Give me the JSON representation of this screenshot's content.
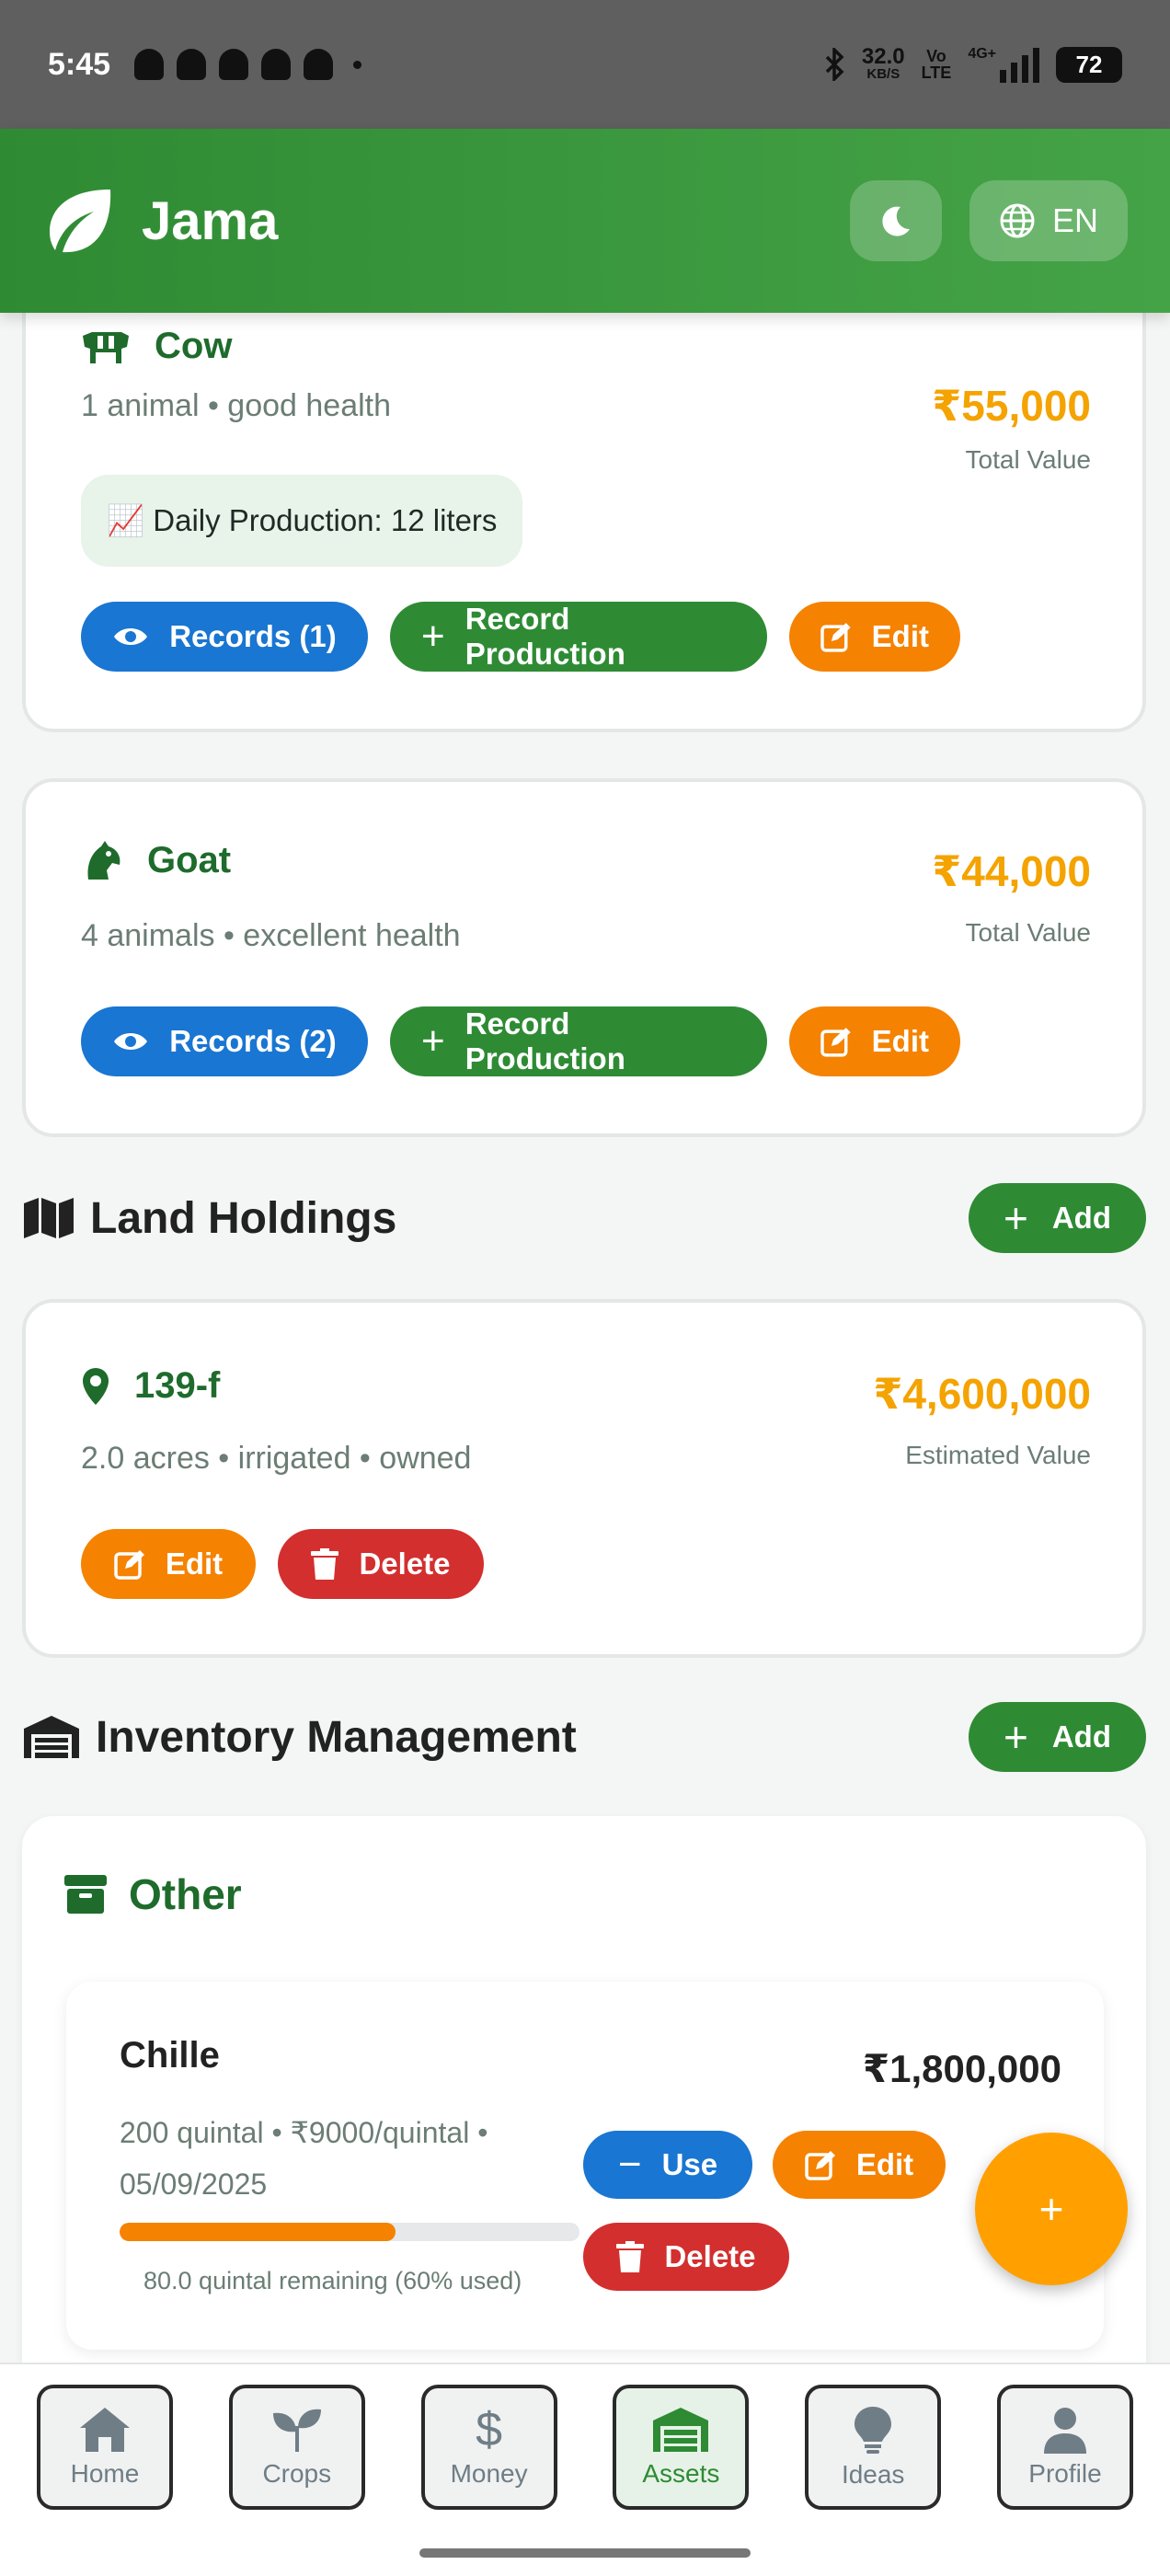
{
  "status_bar": {
    "time": "5:45",
    "net_speed": "32.0",
    "net_unit": "KB/S",
    "volte_top": "Vo",
    "volte_bottom": "LTE",
    "network": "4G+",
    "battery": "72"
  },
  "header": {
    "title": "Jama",
    "language": "EN",
    "theme_icon": "moon-icon",
    "language_icon": "globe-icon"
  },
  "livestock": [
    {
      "name": "Cow",
      "summary": "1 animal • good health",
      "value": "₹55,000",
      "value_caption": "Total Value",
      "production": "📈 Daily Production: 12 liters",
      "records_label": "Records (1)",
      "record_production_label": "Record Production",
      "edit_label": "Edit"
    },
    {
      "name": "Goat",
      "summary": "4 animals • excellent health",
      "value": "₹44,000",
      "value_caption": "Total Value",
      "records_label": "Records (2)",
      "record_production_label": "Record Production",
      "edit_label": "Edit"
    }
  ],
  "land": {
    "section_title": "Land Holdings",
    "add_label": "Add",
    "items": [
      {
        "name": "139-f",
        "summary": "2.0 acres • irrigated • owned",
        "value": "₹4,600,000",
        "value_caption": "Estimated Value",
        "edit_label": "Edit",
        "delete_label": "Delete"
      }
    ]
  },
  "inventory": {
    "section_title": "Inventory Management",
    "add_label": "Add",
    "category": "Other",
    "items": [
      {
        "name": "Chille",
        "value": "₹1,800,000",
        "detail_line1": "200 quintal • ₹9000/quintal •",
        "detail_line2": "05/09/2025",
        "used_fraction": 0.6,
        "remaining": "80.0 quintal remaining (60% used)",
        "use_label": "Use",
        "edit_label": "Edit",
        "delete_label": "Delete"
      }
    ]
  },
  "fab": {
    "label": "+"
  },
  "nav": {
    "tabs": [
      {
        "label": "Home",
        "icon": "home-icon"
      },
      {
        "label": "Crops",
        "icon": "sprout-icon"
      },
      {
        "label": "Money",
        "icon": "dollar-icon"
      },
      {
        "label": "Assets",
        "icon": "warehouse-icon",
        "active": true
      },
      {
        "label": "Ideas",
        "icon": "lightbulb-icon"
      },
      {
        "label": "Profile",
        "icon": "person-icon"
      }
    ]
  },
  "colors": {
    "primary": "#2e8b34",
    "accent": "#f4a300",
    "blue": "#1976d2",
    "orange": "#f58200",
    "red": "#d32f2f"
  }
}
